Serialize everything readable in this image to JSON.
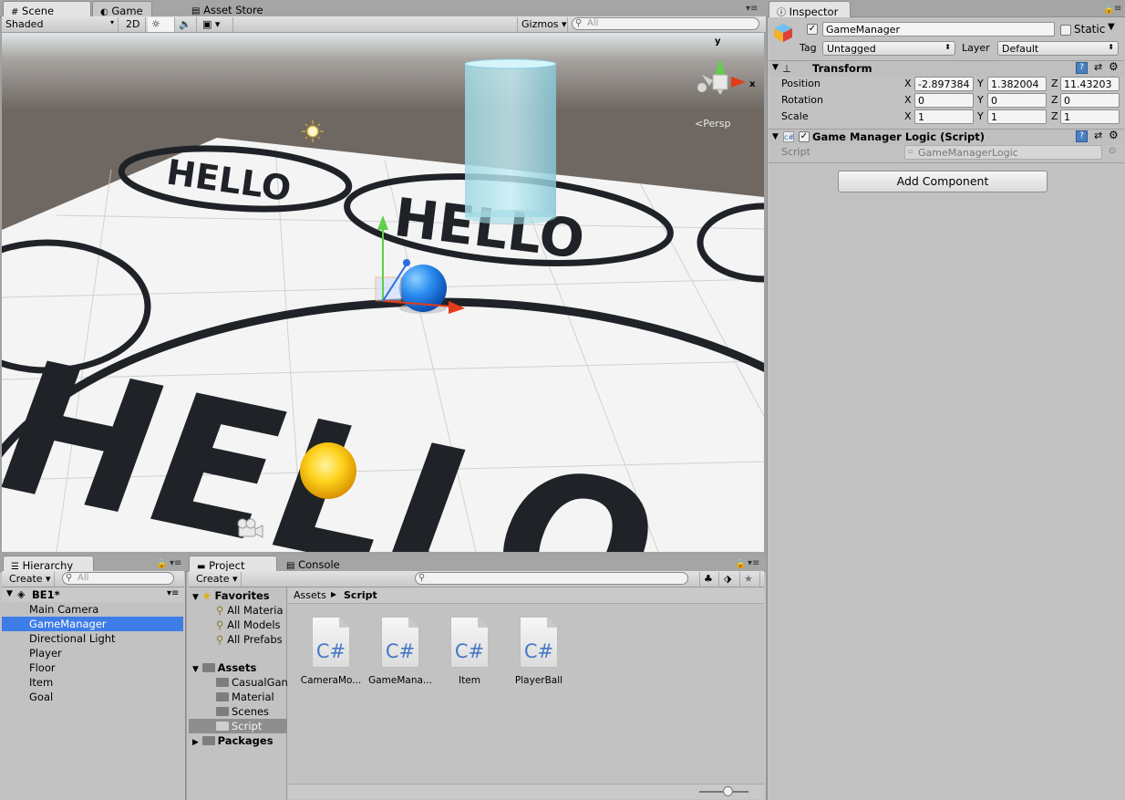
{
  "scene_panel": {
    "tabs": [
      {
        "label": "Scene"
      },
      {
        "label": "Game"
      },
      {
        "label": "Asset Store"
      }
    ],
    "shading_mode": "Shaded",
    "mode_2d": "2D",
    "gizmos_label": "Gizmos",
    "search_placeholder": "All",
    "gizmo_axes": {
      "y": "y",
      "x": "x"
    },
    "projection": "Persp",
    "floor_text": "HELLO"
  },
  "inspector": {
    "tab_label": "Inspector",
    "object_name": "GameManager",
    "static_label": "Static",
    "tag_label": "Tag",
    "tag_value": "Untagged",
    "layer_label": "Layer",
    "layer_value": "Default",
    "transform": {
      "title": "Transform",
      "position_label": "Position",
      "rotation_label": "Rotation",
      "scale_label": "Scale",
      "x_label": "X",
      "y_label": "Y",
      "z_label": "Z",
      "position": {
        "x": "-2.897384",
        "y": "1.382004",
        "z": "11.43203"
      },
      "rotation": {
        "x": "0",
        "y": "0",
        "z": "0"
      },
      "scale": {
        "x": "1",
        "y": "1",
        "z": "1"
      }
    },
    "script_component": {
      "title": "Game Manager Logic (Script)",
      "script_label": "Script",
      "script_value": "GameManagerLogic"
    },
    "add_component_label": "Add Component"
  },
  "hierarchy": {
    "tab_label": "Hierarchy",
    "create_label": "Create",
    "search_placeholder": "All",
    "scene_name": "BE1*",
    "items": [
      {
        "label": "Main Camera"
      },
      {
        "label": "GameManager"
      },
      {
        "label": "Directional Light"
      },
      {
        "label": "Player"
      },
      {
        "label": "Floor"
      },
      {
        "label": "Item"
      },
      {
        "label": "Goal"
      }
    ]
  },
  "project": {
    "tabs": [
      {
        "label": "Project"
      },
      {
        "label": "Console"
      }
    ],
    "create_label": "Create",
    "favorites_label": "Favorites",
    "favorites": [
      {
        "label": "All Materia"
      },
      {
        "label": "All Models"
      },
      {
        "label": "All Prefabs"
      }
    ],
    "assets_label": "Assets",
    "asset_folders": [
      {
        "label": "CasualGan"
      },
      {
        "label": "Material"
      },
      {
        "label": "Scenes"
      },
      {
        "label": "Script"
      }
    ],
    "packages_label": "Packages",
    "breadcrumb": {
      "root": "Assets",
      "current": "Script"
    },
    "file_glyph": "C#",
    "files": [
      {
        "label": "CameraMo..."
      },
      {
        "label": "GameMana..."
      },
      {
        "label": "Item"
      },
      {
        "label": "PlayerBall"
      }
    ]
  }
}
